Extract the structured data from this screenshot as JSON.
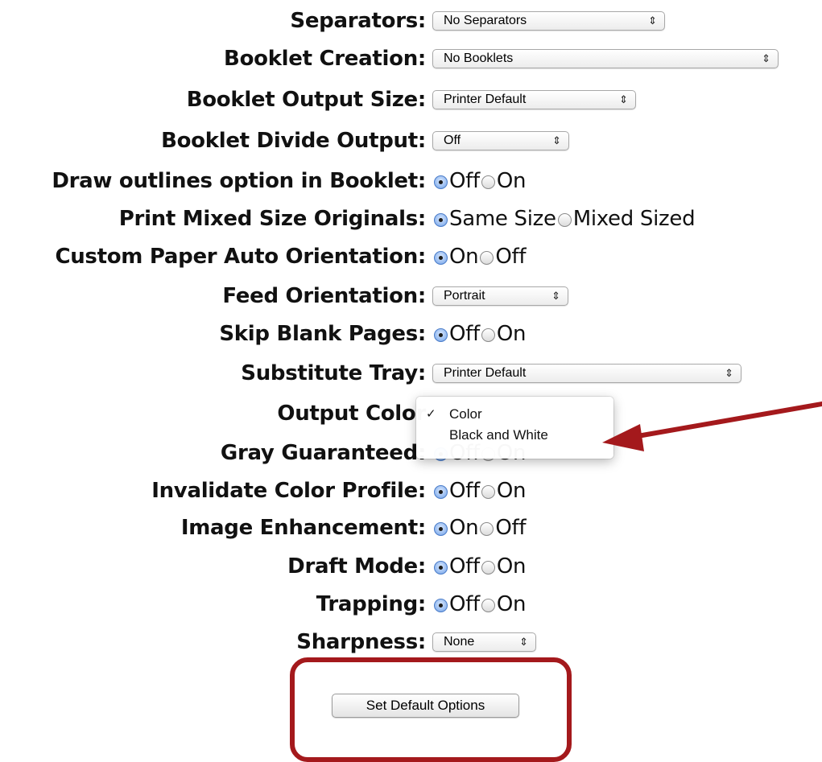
{
  "options": [
    {
      "id": "separators",
      "label": "Separators:",
      "type": "select",
      "value": "No Separators"
    },
    {
      "id": "booklet-creation",
      "label": "Booklet Creation:",
      "type": "select",
      "value": "No Booklets"
    },
    {
      "id": "booklet-output-size",
      "label": "Booklet Output Size:",
      "type": "select",
      "value": "Printer Default"
    },
    {
      "id": "booklet-divide-output",
      "label": "Booklet Divide Output:",
      "type": "select",
      "value": "Off"
    },
    {
      "id": "draw-outlines",
      "label": "Draw outlines option in Booklet:",
      "type": "radio",
      "options": [
        "Off",
        "On"
      ],
      "selected": "Off"
    },
    {
      "id": "print-mixed-size",
      "label": "Print Mixed Size Originals:",
      "type": "radio",
      "options": [
        "Same Size",
        "Mixed Sized"
      ],
      "selected": "Same Size"
    },
    {
      "id": "custom-paper-auto-orientation",
      "label": "Custom Paper Auto Orientation:",
      "type": "radio",
      "options": [
        "On",
        "Off"
      ],
      "selected": "On"
    },
    {
      "id": "feed-orientation",
      "label": "Feed Orientation:",
      "type": "select",
      "value": "Portrait"
    },
    {
      "id": "skip-blank-pages",
      "label": "Skip Blank Pages:",
      "type": "radio",
      "options": [
        "Off",
        "On"
      ],
      "selected": "Off"
    },
    {
      "id": "substitute-tray",
      "label": "Substitute Tray:",
      "type": "select",
      "value": "Printer Default"
    },
    {
      "id": "output-color",
      "label": "Output Color",
      "type": "select-open"
    },
    {
      "id": "gray-guaranteed",
      "label": "Gray Guaranteed:",
      "type": "radio",
      "options": [
        "Off",
        "On"
      ],
      "selected": "Off"
    },
    {
      "id": "invalidate-color-profile",
      "label": "Invalidate Color Profile:",
      "type": "radio",
      "options": [
        "Off",
        "On"
      ],
      "selected": "Off"
    },
    {
      "id": "image-enhancement",
      "label": "Image Enhancement:",
      "type": "radio",
      "options": [
        "On",
        "Off"
      ],
      "selected": "On"
    },
    {
      "id": "draft-mode",
      "label": "Draft Mode:",
      "type": "radio",
      "options": [
        "Off",
        "On"
      ],
      "selected": "Off"
    },
    {
      "id": "trapping",
      "label": "Trapping:",
      "type": "radio",
      "options": [
        "Off",
        "On"
      ],
      "selected": "Off"
    },
    {
      "id": "sharpness",
      "label": "Sharpness:",
      "type": "select",
      "value": "None"
    }
  ],
  "output_color_menu": {
    "items": [
      {
        "label": "Color",
        "checked": true,
        "check_glyph": "✓"
      },
      {
        "label": "Black and White",
        "checked": false,
        "check_glyph": ""
      }
    ]
  },
  "select_arrows_glyph": "⇕",
  "default_button": {
    "label": "Set Default Options"
  },
  "colors": {
    "callout": "#a4191c",
    "radio_selected": "#5a8fdc"
  }
}
